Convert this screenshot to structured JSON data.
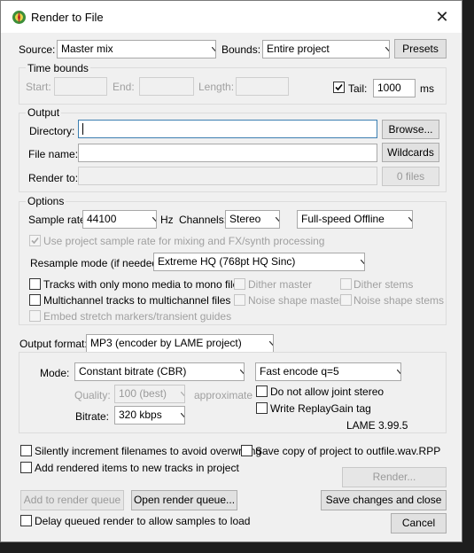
{
  "window": {
    "title": "Render to File",
    "close_glyph": "✕"
  },
  "source": {
    "label": "Source:",
    "value": "Master mix"
  },
  "bounds": {
    "label": "Bounds:",
    "value": "Entire project"
  },
  "presets_button": "Presets",
  "time_bounds": {
    "title": "Time bounds",
    "start_label": "Start:",
    "end_label": "End:",
    "length_label": "Length:",
    "tail_label": "Tail:",
    "tail_checked": true,
    "tail_value": "1000",
    "tail_unit": "ms"
  },
  "output": {
    "title": "Output",
    "directory_label": "Directory:",
    "directory_value": "",
    "browse_button": "Browse...",
    "filename_label": "File name:",
    "filename_value": "",
    "wildcards_button": "Wildcards",
    "render_to_label": "Render to:",
    "render_to_value": "",
    "files_button": "0 files"
  },
  "options": {
    "title": "Options",
    "sample_rate_label": "Sample rate:",
    "sample_rate_value": "44100",
    "hz_label": "Hz",
    "channels_label": "Channels:",
    "channels_value": "Stereo",
    "speed_value": "Full-speed Offline",
    "use_project_rate_label": "Use project sample rate for mixing and FX/synth processing",
    "resample_label": "Resample mode (if needed):",
    "resample_value": "Extreme HQ (768pt HQ Sinc)",
    "mono_tracks_label": "Tracks with only mono media to mono file",
    "multichannel_label": "Multichannel tracks to multichannel files",
    "embed_label": "Embed stretch markers/transient guides",
    "dither_master_label": "Dither master",
    "noise_shape_master_label": "Noise shape master",
    "dither_stems_label": "Dither stems",
    "noise_shape_stems_label": "Noise shape stems"
  },
  "output_format": {
    "label": "Output format:",
    "value": "MP3 (encoder by LAME project)",
    "mode_label": "Mode:",
    "mode_value": "Constant bitrate  (CBR)",
    "encode_value": "Fast encode q=5",
    "quality_label": "Quality:",
    "quality_value": "100 (best)",
    "approximate_label": "approximate",
    "no_joint_stereo_label": "Do not allow joint stereo",
    "replaygain_label": "Write ReplayGain tag",
    "bitrate_label": "Bitrate:",
    "bitrate_value": "320 kbps",
    "lame_version": "LAME 3.99.5"
  },
  "footer": {
    "silently_increment_label": "Silently increment filenames to avoid overwriting",
    "save_copy_label": "Save copy of project to outfile.wav.RPP",
    "add_rendered_label": "Add rendered items to new tracks in project",
    "render_button": "Render...",
    "add_queue_button": "Add to render queue",
    "open_queue_button": "Open render queue...",
    "save_close_button": "Save changes and close",
    "delay_queued_label": "Delay queued render to allow samples to load",
    "cancel_button": "Cancel"
  }
}
